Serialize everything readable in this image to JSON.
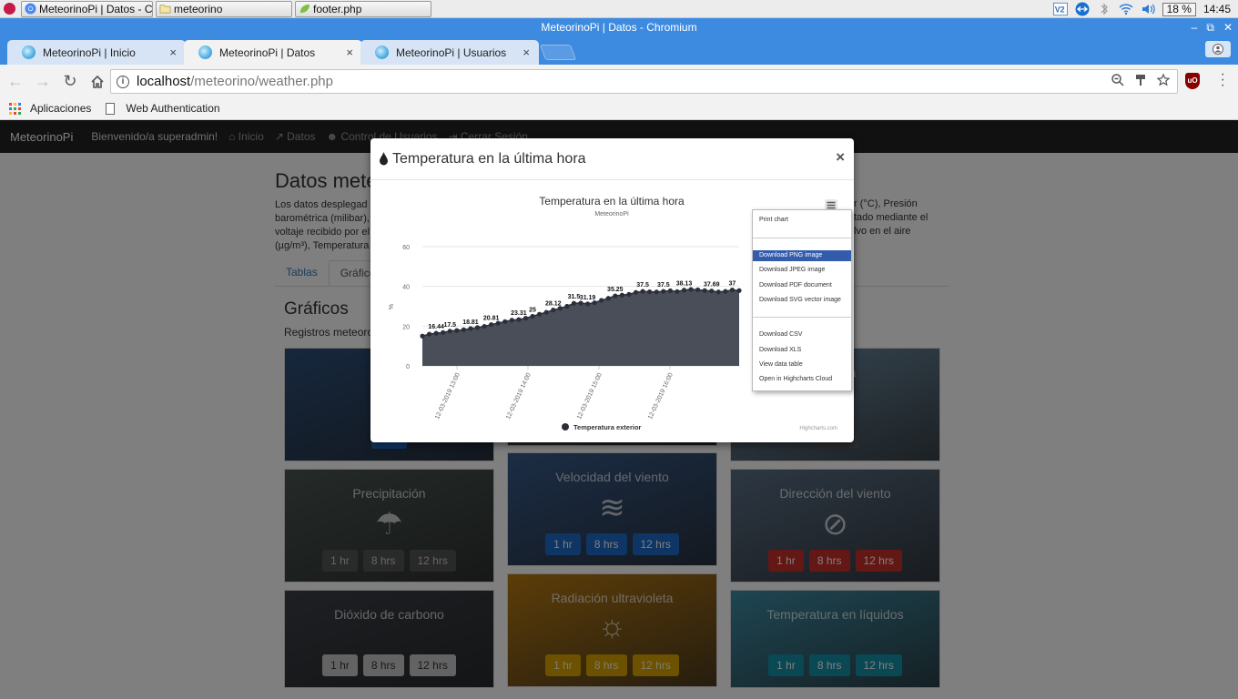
{
  "taskbar": {
    "tasks": [
      {
        "label": "MeteorinoPi | Datos - Ch..."
      },
      {
        "label": "meteorino"
      },
      {
        "label": "footer.php"
      }
    ],
    "battery": "18 %",
    "clock": "14:45"
  },
  "window": {
    "title": "MeteorinoPi | Datos - Chromium",
    "controls": [
      "–",
      "⧉",
      "✕"
    ]
  },
  "tabs": [
    {
      "label": "MeteorinoPi | Inicio",
      "close": "×"
    },
    {
      "label": "MeteorinoPi | Datos",
      "close": "×"
    },
    {
      "label": "MeteorinoPi | Usuarios",
      "close": "×"
    }
  ],
  "address": {
    "host": "localhost",
    "path": "/meteorino/weather.php"
  },
  "bookmarks": [
    {
      "label": "Aplicaciones"
    },
    {
      "label": "Web Authentication"
    }
  ],
  "navbar": {
    "brand": "MeteorinoPi",
    "welcome": "Bienvenido/a superadmin!",
    "items": [
      "Inicio",
      "Datos",
      "Control de Usuarios",
      "Cerrar Sesión"
    ]
  },
  "content": {
    "title": "Datos mete",
    "intro_lines": [
      "Los datos desplegad",
      "barométrica (milibar), ",
      "voltaje recibido por el ",
      "(µg/m³), Temperatura "
    ],
    "intro_right": [
      "r (°C), Presión",
      "tado mediante el",
      "lvo en el aire"
    ],
    "tabs": [
      "Tablas",
      "Gráficos"
    ],
    "section_title": "Gráficos",
    "section_desc": "Registros meteorol"
  },
  "cards": [
    {
      "title": "Hume",
      "icon": "",
      "buttons": [
        "1 hr"
      ],
      "style": "blue",
      "bg": "#2d4f7a"
    },
    {
      "title": "",
      "icon": "",
      "buttons": [],
      "style": "gray",
      "bg": "#555"
    },
    {
      "title": "métrica",
      "icon": "",
      "buttons": [
        "12 hrs"
      ],
      "style": "gray",
      "bg": "#6f8fa6"
    },
    {
      "title": "Precipitación",
      "icon": "☂",
      "buttons": [
        "1 hr",
        "8 hrs",
        "12 hrs"
      ],
      "style": "gray",
      "bg": "#4a5653"
    },
    {
      "title": "Velocidad del viento",
      "icon": "≋",
      "buttons": [
        "1 hr",
        "8 hrs",
        "12 hrs"
      ],
      "style": "blue",
      "bg": "#375a8a"
    },
    {
      "title": "Dirección del viento",
      "icon": "⊘",
      "buttons": [
        "1 hr",
        "8 hrs",
        "12 hrs"
      ],
      "style": "red",
      "bg": "#5a6f86"
    },
    {
      "title": "Dióxido de carbono",
      "icon": "",
      "buttons": [
        "1 hr",
        "8 hrs",
        "12 hrs"
      ],
      "style": "light",
      "bg": "#3b3f46"
    },
    {
      "title": "Radiación ultravioleta",
      "icon": "☼",
      "buttons": [
        "1 hr",
        "8 hrs",
        "12 hrs"
      ],
      "style": "yellow",
      "bg": "#b87a12"
    },
    {
      "title": "Temperatura en líquidos",
      "icon": "",
      "buttons": [
        "1 hr",
        "8 hrs",
        "12 hrs"
      ],
      "style": "teal",
      "bg": "#3d8ca6"
    }
  ],
  "modal": {
    "title": "Temperatura en la última hora",
    "close": "×"
  },
  "chart_data": {
    "type": "area",
    "title": "Temperatura en la última hora",
    "subtitle": "MeteorinoPi",
    "ylabel": "%",
    "ylim": [
      0,
      60
    ],
    "yticks": [
      0,
      20,
      40,
      60
    ],
    "xticks": [
      "12-03-2019 13:00",
      "12-03-2019 14:00",
      "12-03-2019 15:00",
      "12-03-2019 16:00"
    ],
    "series": [
      {
        "name": "Temperatura exterior",
        "color": "#2b2f3a",
        "fill": "#4a4e59",
        "values": [
          15.0,
          16.0,
          16.44,
          16.8,
          17.5,
          17.8,
          18.2,
          18.81,
          19.3,
          19.9,
          20.81,
          21.5,
          22.3,
          23.0,
          23.31,
          24.0,
          25,
          26.0,
          27.0,
          28.12,
          29.0,
          30.0,
          31.5,
          31.6,
          31.19,
          31.8,
          33.0,
          34.0,
          35.25,
          35.6,
          36.0,
          37.0,
          37.5,
          37.3,
          37.2,
          37.5,
          37.8,
          37.4,
          38.13,
          38.5,
          38.3,
          37.9,
          37.69,
          37.2,
          37.5,
          38.2,
          37.9
        ],
        "labels": {
          "2": "16.44",
          "4": "17.5",
          "7": "18.81",
          "10": "20.81",
          "14": "23.31",
          "16": "25",
          "19": "28.12",
          "22": "31.5",
          "24": "31.19",
          "28": "35.25",
          "32": "37.5",
          "35": "37.5",
          "38": "38.13",
          "42": "37.69",
          "45": "37"
        }
      }
    ],
    "legend": "bottom-center",
    "credits": "Highcharts.com"
  },
  "export_menu": {
    "items": [
      "Print chart",
      "Download PNG image",
      "Download JPEG image",
      "Download PDF document",
      "Download SVG vector image",
      "Download CSV",
      "Download XLS",
      "View data table",
      "Open in Highcharts Cloud"
    ],
    "highlighted": "Download PNG image"
  }
}
